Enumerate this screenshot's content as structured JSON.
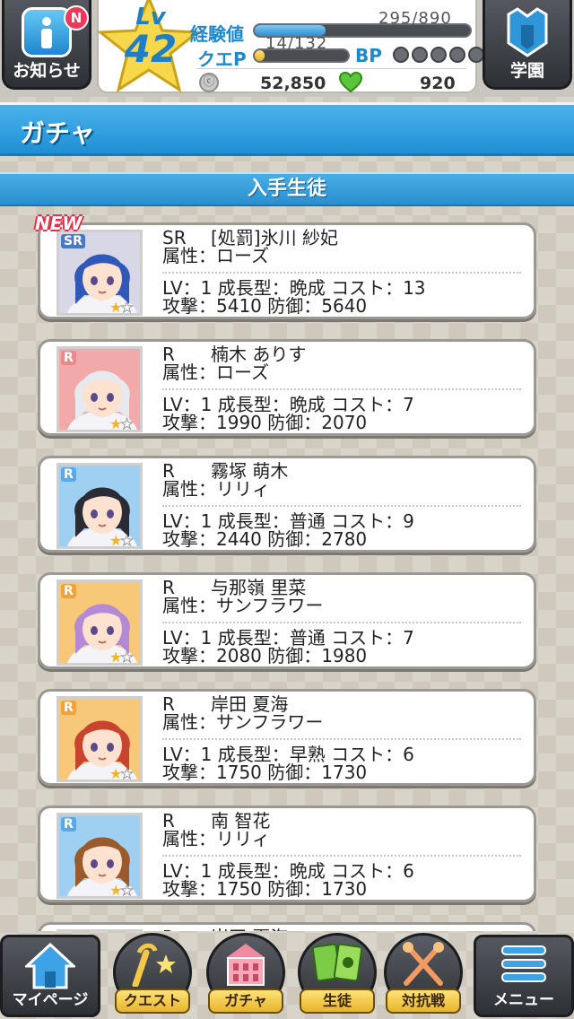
{
  "hud": {
    "info_label": "お知らせ",
    "info_badge": "N",
    "school_label": "学園",
    "lv_prefix": "Lv",
    "level": "42",
    "exp_label": "経験値",
    "exp_value": "295/890",
    "exp_fraction": 0.33,
    "quest_label": "クエP",
    "quest_value": "14/132",
    "quest_fraction": 0.11,
    "bp_label": "BP",
    "bp_dots": 5,
    "coin_symbol": "ⓒ",
    "coins": "52,850",
    "hearts": "920",
    "accent": "#1f88cf"
  },
  "title": "ガチャ",
  "section_title": "入手生徒",
  "new_tag": "NEW",
  "cards": [
    {
      "rarity": "SR",
      "name": "[処罰]氷川 紗妃",
      "attr_line": "属性：ローズ",
      "lv_line": "LV：1 成長型：晩成 コスト：13",
      "atk_line": "攻撃：5410 防御：5640",
      "stars": 1,
      "is_new": true,
      "theme": "#4a78c9",
      "frame": "#d7d7e6",
      "hair": "#2f58b8"
    },
    {
      "rarity": "R",
      "name": "楠木 ありす",
      "attr_line": "属性：ローズ",
      "lv_line": "LV：1 成長型：晩成 コスト：7",
      "atk_line": "攻撃：1990 防御：2070",
      "stars": 1,
      "is_new": false,
      "theme": "#e98a8a",
      "frame": "#f2a9a9",
      "hair": "#e6e9ee"
    },
    {
      "rarity": "R",
      "name": "霧塚 萌木",
      "attr_line": "属性：リリィ",
      "lv_line": "LV：1 成長型：普通 コスト：9",
      "atk_line": "攻撃：2440 防御：2780",
      "stars": 1,
      "is_new": false,
      "theme": "#59a9e6",
      "frame": "#9fd0f2",
      "hair": "#2b2b33"
    },
    {
      "rarity": "R",
      "name": "与那嶺 里菜",
      "attr_line": "属性：サンフラワー",
      "lv_line": "LV：1 成長型：普通 コスト：7",
      "atk_line": "攻撃：2080 防御：1980",
      "stars": 1,
      "is_new": false,
      "theme": "#f0a33c",
      "frame": "#f6c878",
      "hair": "#b489d6"
    },
    {
      "rarity": "R",
      "name": "岸田 夏海",
      "attr_line": "属性：サンフラワー",
      "lv_line": "LV：1 成長型：早熟 コスト：6",
      "atk_line": "攻撃：1750 防御：1730",
      "stars": 1,
      "is_new": false,
      "theme": "#f0a33c",
      "frame": "#f6c878",
      "hair": "#c9442f"
    },
    {
      "rarity": "R",
      "name": "南 智花",
      "attr_line": "属性：リリィ",
      "lv_line": "LV：1 成長型：晩成 コスト：6",
      "atk_line": "攻撃：1750 防御：1730",
      "stars": 1,
      "is_new": false,
      "theme": "#59a9e6",
      "frame": "#9fd0f2",
      "hair": "#9a5a2c"
    },
    {
      "rarity": "R",
      "name": "岸田 夏海",
      "attr_line": "",
      "lv_line": "",
      "atk_line": "",
      "stars": 1,
      "is_new": false,
      "theme": "#f0a33c",
      "frame": "#f6c878",
      "hair": "#c9442f"
    }
  ],
  "nav": {
    "mypage": "マイページ",
    "quest": "クエスト",
    "gacha": "ガチャ",
    "students": "生徒",
    "battle": "対抗戦",
    "menu": "メニュー"
  }
}
